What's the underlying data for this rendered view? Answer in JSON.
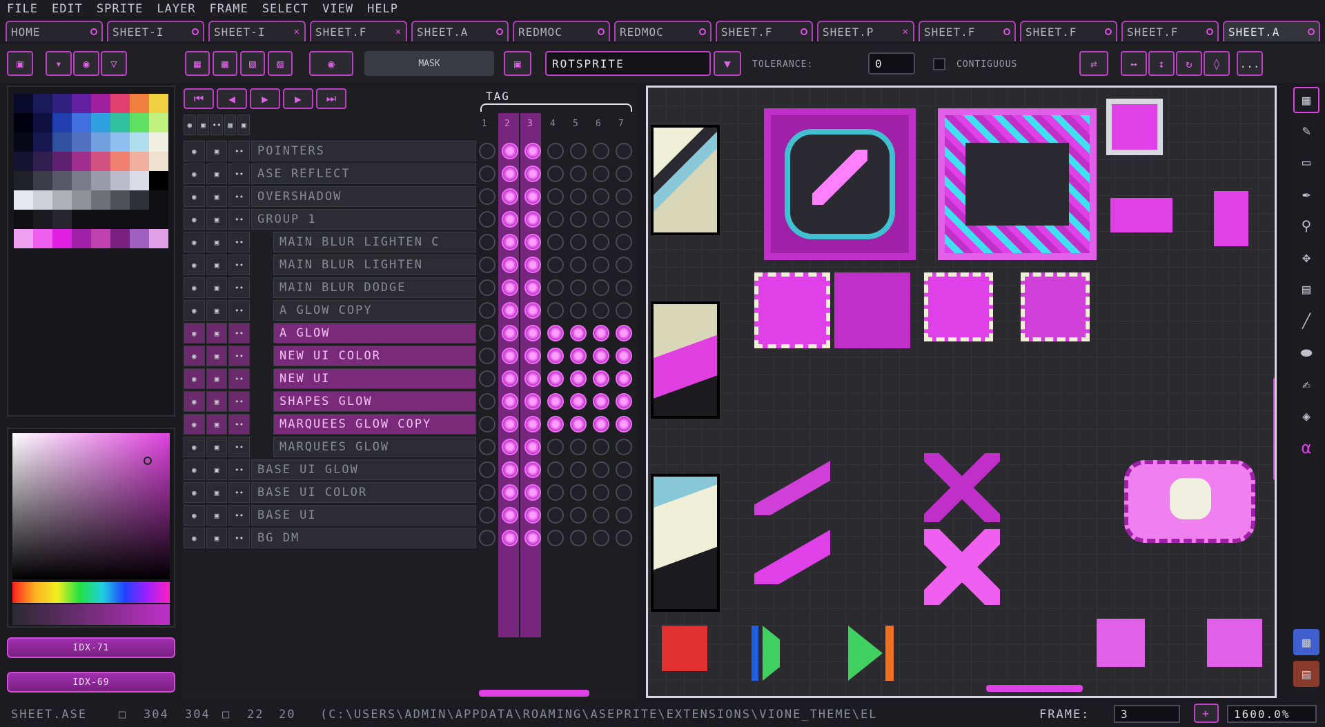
{
  "menu": [
    "FILE",
    "EDIT",
    "SPRITE",
    "LAYER",
    "FRAME",
    "SELECT",
    "VIEW",
    "HELP"
  ],
  "tabs": [
    {
      "label": "HOME",
      "close": "o"
    },
    {
      "label": "SHEET-I",
      "close": "o"
    },
    {
      "label": "SHEET-I",
      "close": "x"
    },
    {
      "label": "SHEET.F",
      "close": "x"
    },
    {
      "label": "SHEET.A",
      "close": "o"
    },
    {
      "label": "REDMOC",
      "close": "o"
    },
    {
      "label": "REDMOC",
      "close": "o"
    },
    {
      "label": "SHEET.F",
      "close": "o"
    },
    {
      "label": "SHEET.P",
      "close": "x"
    },
    {
      "label": "SHEET.F",
      "close": "o"
    },
    {
      "label": "SHEET.F",
      "close": "o"
    },
    {
      "label": "SHEET.F",
      "close": "o"
    },
    {
      "label": "SHEET.A",
      "close": "o"
    }
  ],
  "toolbar": {
    "mask_label": "MASK",
    "algorithm": "ROTSPRITE",
    "tolerance_label": "TOLERANCE:",
    "tolerance_value": "0",
    "contiguous_label": "CONTIGUOUS",
    "more_label": "..."
  },
  "timeline": {
    "tag_label": "TAG",
    "frames": [
      "1",
      "2",
      "3",
      "4",
      "5",
      "6",
      "7"
    ],
    "layers": [
      {
        "name": "POINTERS",
        "indent": false,
        "selected": false
      },
      {
        "name": "ASE REFLECT",
        "indent": false,
        "selected": false
      },
      {
        "name": "OVERSHADOW",
        "indent": false,
        "selected": false
      },
      {
        "name": "GROUP 1",
        "indent": false,
        "selected": false
      },
      {
        "name": "MAIN BLUR LIGHTEN C",
        "indent": true,
        "selected": false
      },
      {
        "name": "MAIN BLUR LIGHTEN",
        "indent": true,
        "selected": false
      },
      {
        "name": "MAIN BLUR DODGE",
        "indent": true,
        "selected": false
      },
      {
        "name": "A GLOW COPY",
        "indent": true,
        "selected": false
      },
      {
        "name": "A GLOW",
        "indent": true,
        "selected": true
      },
      {
        "name": "NEW UI COLOR",
        "indent": true,
        "selected": true
      },
      {
        "name": "NEW UI",
        "indent": true,
        "selected": true
      },
      {
        "name": "SHAPES GLOW",
        "indent": true,
        "selected": true
      },
      {
        "name": "MARQUEES GLOW COPY",
        "indent": true,
        "selected": true
      },
      {
        "name": "MARQUEES GLOW",
        "indent": true,
        "selected": false
      },
      {
        "name": "BASE UI GLOW",
        "indent": false,
        "selected": false
      },
      {
        "name": "BASE UI COLOR",
        "indent": false,
        "selected": false
      },
      {
        "name": "BASE UI",
        "indent": false,
        "selected": false
      },
      {
        "name": "BG DM",
        "indent": false,
        "selected": false
      }
    ]
  },
  "colors": {
    "fg_index": "IDX-71",
    "bg_index": "IDX-69",
    "accent": "#d040d8"
  },
  "status": {
    "filename": "SHEET.ASE",
    "size_w": "304",
    "size_h": "304",
    "cel_w": "22",
    "cel_h": "20",
    "path": "(C:\\USERS\\ADMIN\\APPDATA\\ROAMING\\ASEPRITE\\EXTENSIONS\\VIONE_THEME\\EL",
    "frame_label": "FRAME:",
    "frame_value": "3",
    "zoom": "1600.0%"
  }
}
